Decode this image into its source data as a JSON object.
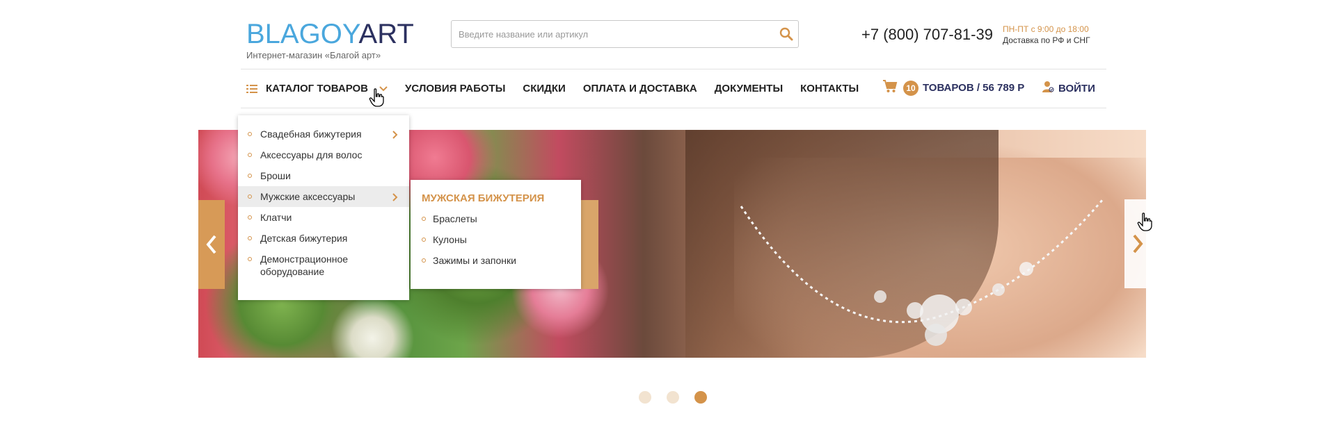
{
  "brand": {
    "logo_part1": "BLAGOY",
    "logo_part2": "ART",
    "tagline": "Интернет-магазин «Благой арт»"
  },
  "search": {
    "placeholder": "Введите название или артикул",
    "value": ""
  },
  "contact": {
    "phone": "+7 (800) 707-81-39",
    "hours": "ПН-ПТ с 9:00 до 18:00",
    "delivery": "Доставка по РФ и СНГ"
  },
  "nav": {
    "items": [
      {
        "label": "Каталог товаров"
      },
      {
        "label": "Условия работы"
      },
      {
        "label": "Скидки"
      },
      {
        "label": "Оплата и доставка"
      },
      {
        "label": "Документы"
      },
      {
        "label": "Контакты"
      }
    ]
  },
  "cart": {
    "count": "10",
    "summary": "ТОВАРОВ / 56 789 Р"
  },
  "login": {
    "label": "ВОЙТИ"
  },
  "catalog_menu": {
    "items": [
      {
        "label": "Свадебная бижутерия",
        "has_sub": true
      },
      {
        "label": "Аксессуары для волос",
        "has_sub": false
      },
      {
        "label": "Броши",
        "has_sub": false
      },
      {
        "label": "Мужские аксессуары",
        "has_sub": true,
        "highlighted": true
      },
      {
        "label": "Клатчи",
        "has_sub": false
      },
      {
        "label": "Детская бижутерия",
        "has_sub": false
      },
      {
        "label": "Демонстрационное оборудование",
        "has_sub": false
      }
    ]
  },
  "submenu": {
    "title": "Мужская бижутерия",
    "items": [
      {
        "label": "Браслеты"
      },
      {
        "label": "Кулоны"
      },
      {
        "label": "Зажимы и запонки"
      }
    ]
  },
  "slider": {
    "slide_count": 3,
    "active_slide": 3
  },
  "colors": {
    "accent": "#d4934a",
    "brand_blue": "#4aa7dd",
    "brand_dark": "#2c3160"
  }
}
